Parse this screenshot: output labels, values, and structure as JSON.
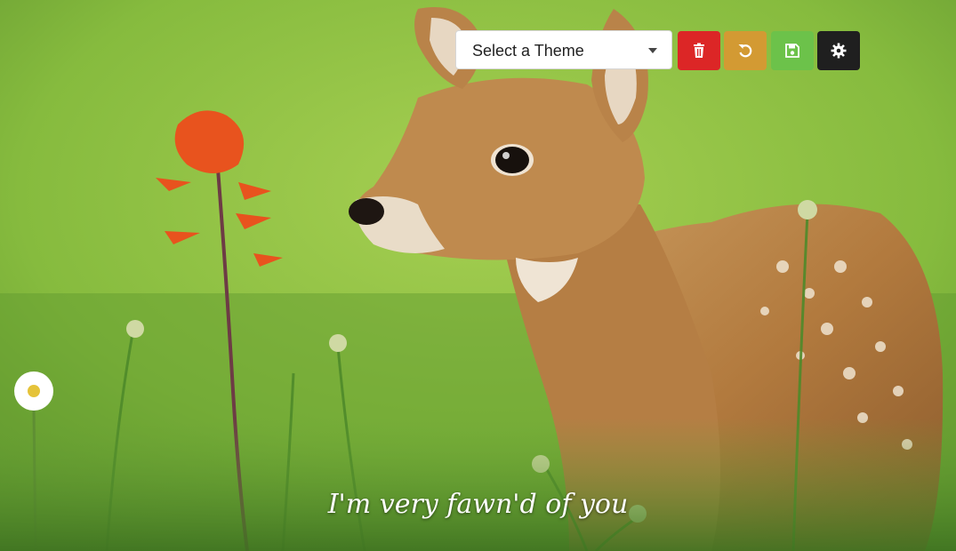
{
  "theme_select": {
    "label": "Select a Theme"
  },
  "toolbar": {
    "buttons": [
      {
        "name": "delete",
        "icon": "trash-icon",
        "color": "#dc2626"
      },
      {
        "name": "reset",
        "icon": "undo-icon",
        "color": "#d39a33"
      },
      {
        "name": "save",
        "icon": "save-icon",
        "color": "#6cc24a"
      },
      {
        "name": "settings",
        "icon": "gear-icon",
        "color": "#1f1f1f"
      }
    ]
  },
  "caption": {
    "text": "I'm very fawn'd of you"
  },
  "colors": {
    "background_green": "#8cc044",
    "caption_text": "#ffffff"
  }
}
